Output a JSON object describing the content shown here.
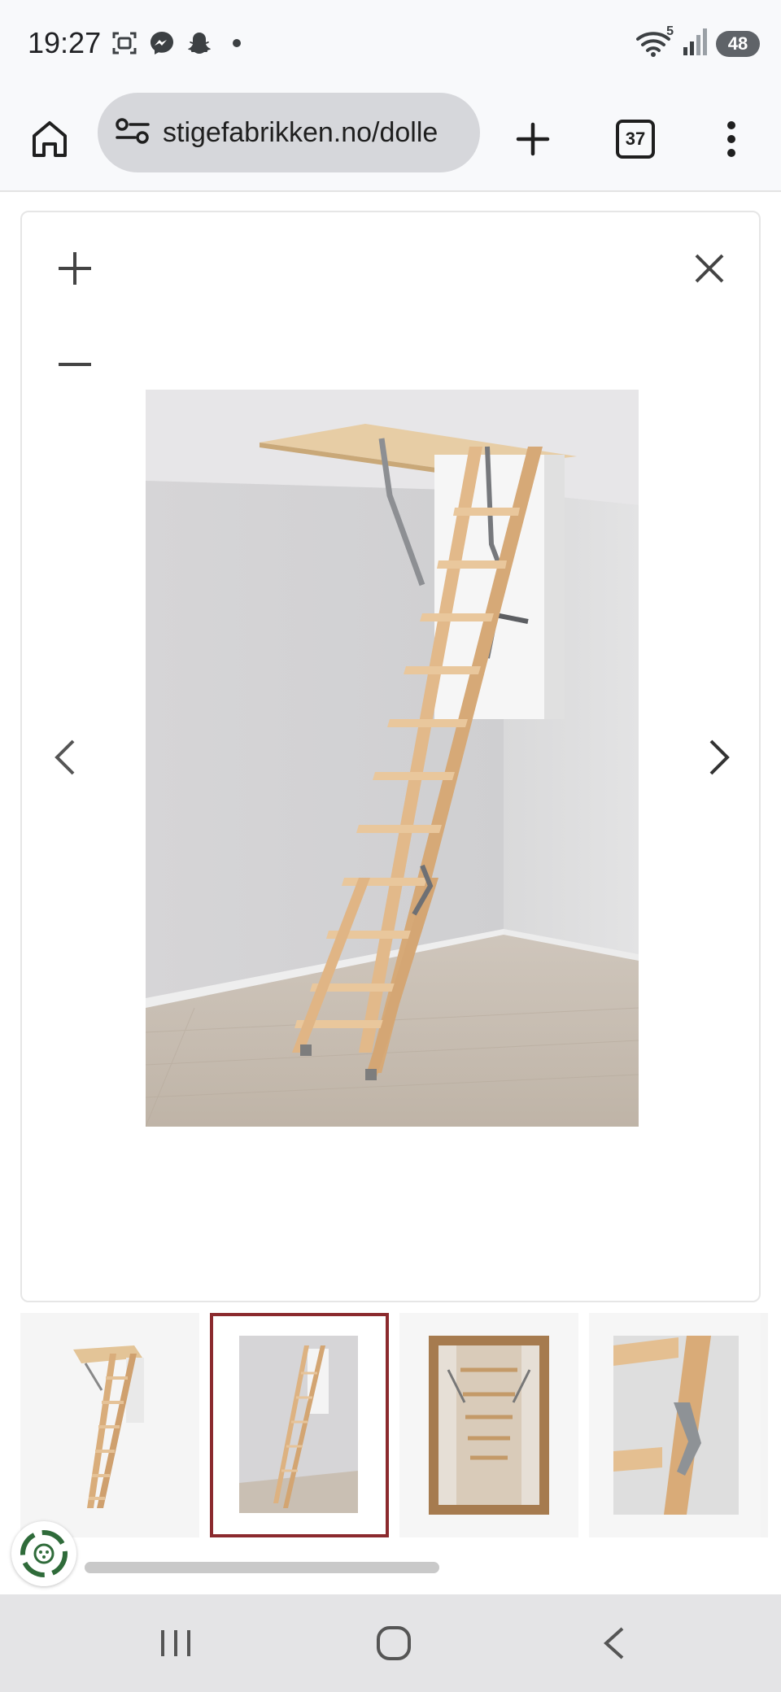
{
  "status_bar": {
    "time": "19:27",
    "left_icons": [
      "screenshot-icon",
      "messenger-icon",
      "snapchat-icon",
      "dot-icon"
    ],
    "right_icons": [
      "wifi-icon",
      "signal-icon"
    ],
    "wifi_badge": "5",
    "battery": "48"
  },
  "browser": {
    "url": "stigefabrikken.no/dolle",
    "tab_count": "37",
    "buttons": [
      "home-icon",
      "site-settings-icon",
      "new-tab-icon",
      "tabs-icon",
      "more-icon"
    ]
  },
  "viewer": {
    "controls": [
      "zoom-in-icon",
      "zoom-out-icon",
      "close-icon",
      "prev-icon",
      "next-icon"
    ],
    "image": "attic ladder extended from ceiling hatch in empty room"
  },
  "thumbnails": {
    "count": 4,
    "selected_index": 1,
    "items": [
      "attic ladder on white background",
      "attic ladder in room",
      "view through hatch",
      "hinge close-up"
    ]
  },
  "colors": {
    "selected_border": "#8b2a2e",
    "chrome_bg": "#f8f9fb",
    "url_pill": "#d6d7db",
    "nav_bg": "#e4e4e6"
  },
  "nav_bar": {
    "buttons": [
      "recents-icon",
      "home-nav-icon",
      "back-icon"
    ]
  }
}
